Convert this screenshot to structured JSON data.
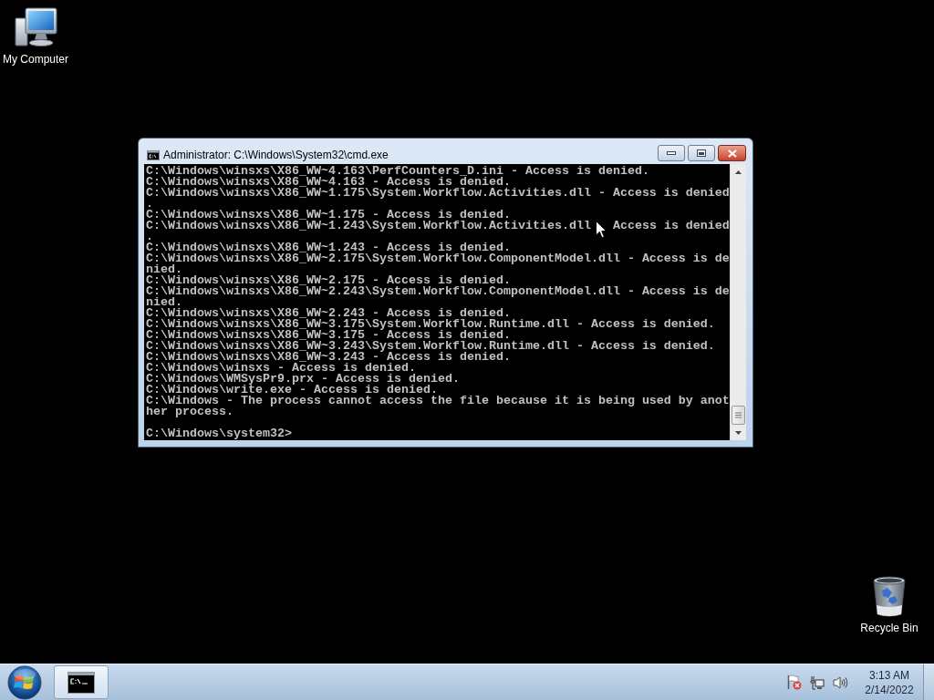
{
  "desktop": {
    "icons": [
      {
        "kind": "computer",
        "label": "My Computer"
      },
      {
        "kind": "recycle_bin",
        "label": "Recycle Bin"
      }
    ]
  },
  "window": {
    "title": "Administrator: C:\\Windows\\System32\\cmd.exe"
  },
  "console": {
    "lines": [
      {
        "kind": "text",
        "text": "C:\\Windows\\winsxs\\X86_WW~4.163\\PerfCounters_D.ini - Access is denied."
      },
      {
        "kind": "text",
        "text": "C:\\Windows\\winsxs\\X86_WW~4.163 - Access is denied."
      },
      {
        "kind": "text",
        "text": "C:\\Windows\\winsxs\\X86_WW~1.175\\System.Workflow.Activities.dll - Access is denied"
      },
      {
        "kind": "text",
        "text": "."
      },
      {
        "kind": "text",
        "text": "C:\\Windows\\winsxs\\X86_WW~1.175 - Access is denied."
      },
      {
        "kind": "under_pointer",
        "before": "C:\\Windows\\winsxs\\X86_WW~1.243\\System.Workflow.Activities.dll",
        "after": "Access is denied"
      },
      {
        "kind": "text",
        "text": "."
      },
      {
        "kind": "text",
        "text": "C:\\Windows\\winsxs\\X86_WW~1.243 - Access is denied."
      },
      {
        "kind": "text",
        "text": "C:\\Windows\\winsxs\\X86_WW~2.175\\System.Workflow.ComponentModel.dll - Access is de"
      },
      {
        "kind": "text",
        "text": "nied."
      },
      {
        "kind": "text",
        "text": "C:\\Windows\\winsxs\\X86_WW~2.175 - Access is denied."
      },
      {
        "kind": "text",
        "text": "C:\\Windows\\winsxs\\X86_WW~2.243\\System.Workflow.ComponentModel.dll - Access is de"
      },
      {
        "kind": "text",
        "text": "nied."
      },
      {
        "kind": "text",
        "text": "C:\\Windows\\winsxs\\X86_WW~2.243 - Access is denied."
      },
      {
        "kind": "text",
        "text": "C:\\Windows\\winsxs\\X86_WW~3.175\\System.Workflow.Runtime.dll - Access is denied."
      },
      {
        "kind": "text",
        "text": "C:\\Windows\\winsxs\\X86_WW~3.175 - Access is denied."
      },
      {
        "kind": "text",
        "text": "C:\\Windows\\winsxs\\X86_WW~3.243\\System.Workflow.Runtime.dll - Access is denied."
      },
      {
        "kind": "text",
        "text": "C:\\Windows\\winsxs\\X86_WW~3.243 - Access is denied."
      },
      {
        "kind": "text",
        "text": "C:\\Windows\\winsxs - Access is denied."
      },
      {
        "kind": "text",
        "text": "C:\\Windows\\WMSysPr9.prx - Access is denied."
      },
      {
        "kind": "text",
        "text": "C:\\Windows\\write.exe - Access is denied."
      },
      {
        "kind": "text",
        "text": "C:\\Windows - The process cannot access the file because it is being used by anot"
      },
      {
        "kind": "text",
        "text": "her process."
      }
    ],
    "prompt": "C:\\Windows\\system32>"
  },
  "taskbar": {
    "clock": {
      "time": "3:13 AM",
      "date": "2/14/2022"
    }
  }
}
